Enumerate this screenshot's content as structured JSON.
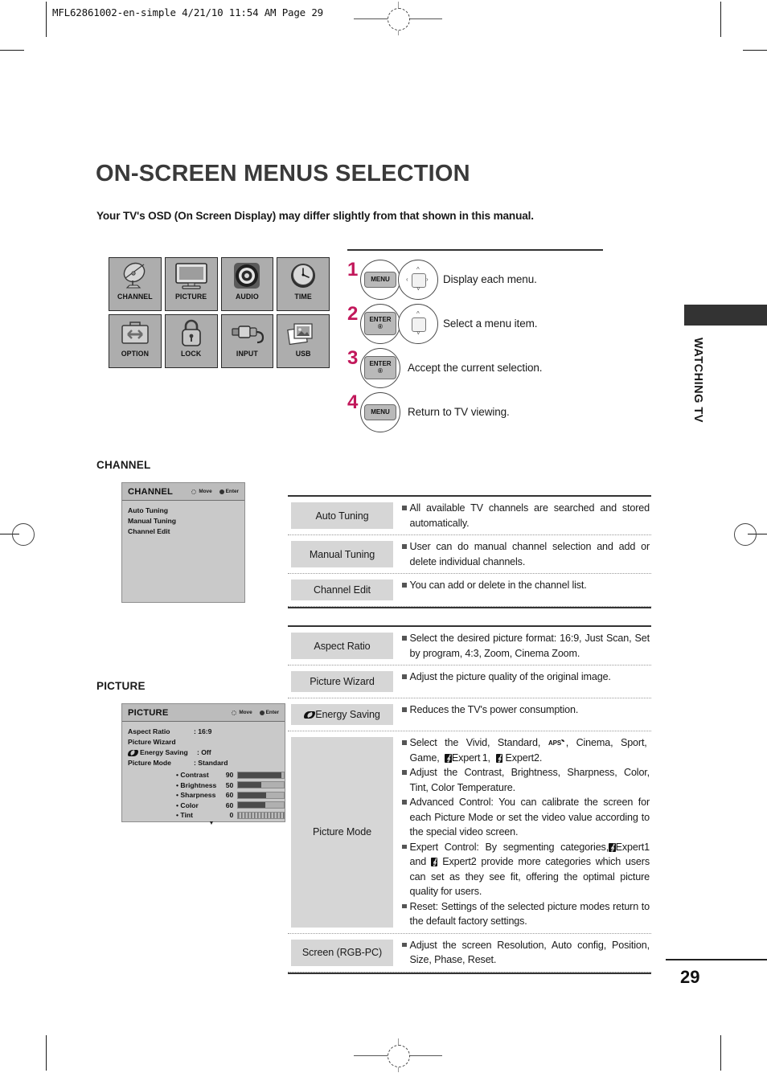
{
  "print": {
    "slug": "MFL62861002-en-simple  4/21/10 11:54 AM  Page 29"
  },
  "page": {
    "title": "ON-SCREEN MENUS SELECTION",
    "lead": "Your TV's OSD (On Screen Display) may differ slightly from that shown in this manual.",
    "number": "29",
    "side_tab_label": "WATCHING TV"
  },
  "menu_icons": [
    {
      "label": "CHANNEL",
      "icon": "satellite-dish-icon"
    },
    {
      "label": "PICTURE",
      "icon": "tv-monitor-icon"
    },
    {
      "label": "AUDIO",
      "icon": "speaker-icon"
    },
    {
      "label": "TIME",
      "icon": "clock-icon"
    },
    {
      "label": "OPTION",
      "icon": "toolbox-icon"
    },
    {
      "label": "LOCK",
      "icon": "padlock-icon"
    },
    {
      "label": "INPUT",
      "icon": "rca-plug-icon"
    },
    {
      "label": "USB",
      "icon": "photos-icon"
    }
  ],
  "steps": [
    {
      "num": "1",
      "keys": [
        "MENU",
        "dpad-4way"
      ],
      "text": "Display each menu."
    },
    {
      "num": "2",
      "keys": [
        "ENTER",
        "dpad-updown"
      ],
      "text": "Select a menu item."
    },
    {
      "num": "3",
      "keys": [
        "ENTER"
      ],
      "text": "Accept the current selection."
    },
    {
      "num": "4",
      "keys": [
        "MENU"
      ],
      "text": "Return to TV viewing."
    }
  ],
  "key_labels": {
    "menu": "MENU",
    "enter": "ENTER",
    "enter_sub": "®"
  },
  "channel": {
    "caption": "CHANNEL",
    "osd": {
      "title": "CHANNEL",
      "hint_move": "Move",
      "hint_enter": "Enter",
      "items": [
        "Auto Tuning",
        "Manual Tuning",
        "Channel Edit"
      ]
    },
    "rows": [
      {
        "name": "Auto Tuning",
        "bullets": [
          "All available TV channels are searched and stored automatically."
        ]
      },
      {
        "name": "Manual Tuning",
        "bullets": [
          "User can do manual channel selection and add or delete individual channels."
        ]
      },
      {
        "name": "Channel Edit",
        "bullets": [
          "You can add or delete in the channel list."
        ]
      }
    ]
  },
  "picture": {
    "caption": "PICTURE",
    "osd": {
      "title": "PICTURE",
      "hint_move": "Move",
      "hint_enter": "Enter",
      "lines": [
        {
          "name": "Aspect Ratio",
          "value": ": 16:9"
        },
        {
          "name": "Picture Wizard",
          "value": ""
        },
        {
          "name": "Energy Saving",
          "value": ": Off",
          "icon": "eco-icon"
        },
        {
          "name": "Picture Mode",
          "value": ": Standard"
        }
      ],
      "sliders": [
        {
          "name": "Contrast",
          "value": "90",
          "percent": 95
        },
        {
          "name": "Brightness",
          "value": "50",
          "percent": 50
        },
        {
          "name": "Sharpness",
          "value": "60",
          "percent": 62
        },
        {
          "name": "Color",
          "value": "60",
          "percent": 60
        },
        {
          "name": "Tint",
          "value": "0",
          "percent": 0,
          "style": "striped"
        }
      ],
      "more_caret": "▼"
    },
    "rows": [
      {
        "name": "Aspect Ratio",
        "bullets": [
          "Select the desired picture format: 16:9, Just Scan, Set by program, 4:3, Zoom, Cinema Zoom."
        ]
      },
      {
        "name": "Picture Wizard",
        "bullets": [
          "Adjust the picture quality of the original image."
        ]
      },
      {
        "name": "Energy Saving",
        "icon": "eco-icon",
        "bullets": [
          "Reduces the TV's power consumption."
        ]
      },
      {
        "name": "Picture Mode",
        "bullets": [
          "Select the Vivid, Standard, [APS], Cinema, Sport, Game, [E]Expert1, [E]Expert2.",
          "Adjust the Contrast, Brightness, Sharpness, Color, Tint, Color Temperature.",
          "Advanced Control: You can calibrate the screen for each Picture Mode or set the video value according to the special video screen.",
          "Expert Control: By segmenting categories, [E]Expert1 and [E]Expert2 provide more categories which users can set as they see fit, offering the optimal picture quality for users.",
          "Reset: Settings of the selected picture modes return to the default factory settings."
        ]
      },
      {
        "name": "Screen (RGB-PC)",
        "bullets": [
          "Adjust the screen Resolution, Auto config, Position, Size, Phase, Reset."
        ]
      }
    ]
  },
  "colors": {
    "step_number": "#c2185b",
    "osd_background": "#c9c9c9",
    "icon_tile": "#adadad",
    "chip": "#d6d6d6",
    "rule": "#333333"
  }
}
